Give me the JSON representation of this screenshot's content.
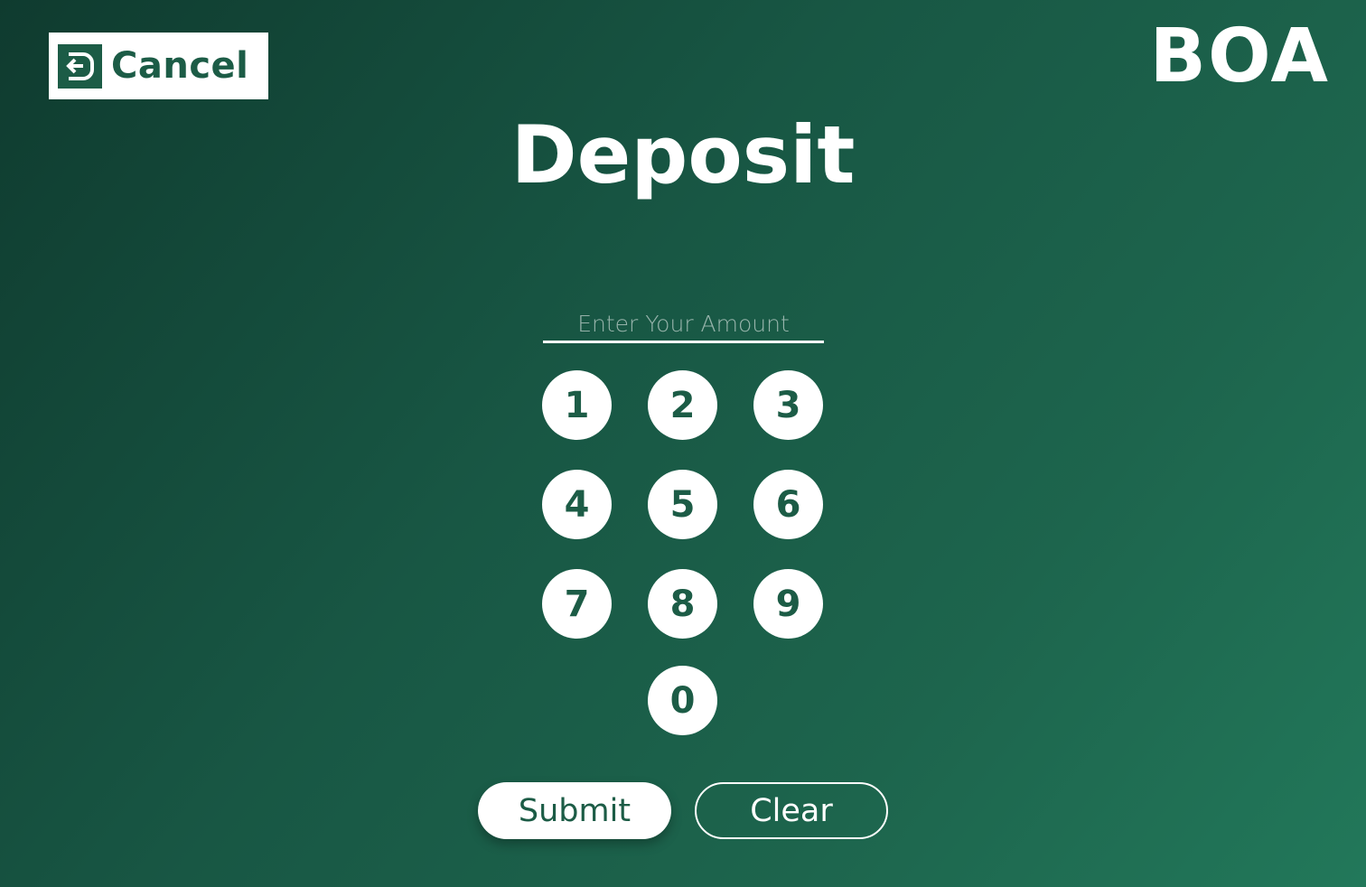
{
  "header": {
    "cancel_label": "Cancel",
    "cancel_icon": "exit-arrow-icon",
    "brand": "BOA"
  },
  "main": {
    "title": "Deposit",
    "amount_input": {
      "placeholder": "Enter Your Amount",
      "value": ""
    },
    "keypad": [
      "1",
      "2",
      "3",
      "4",
      "5",
      "6",
      "7",
      "8",
      "9",
      "0"
    ],
    "submit_label": "Submit",
    "clear_label": "Clear"
  },
  "colors": {
    "accent": "#1c5c46",
    "background_dark": "#0f3b2f",
    "background_light": "#22785a",
    "button_bg": "#ffffff"
  }
}
